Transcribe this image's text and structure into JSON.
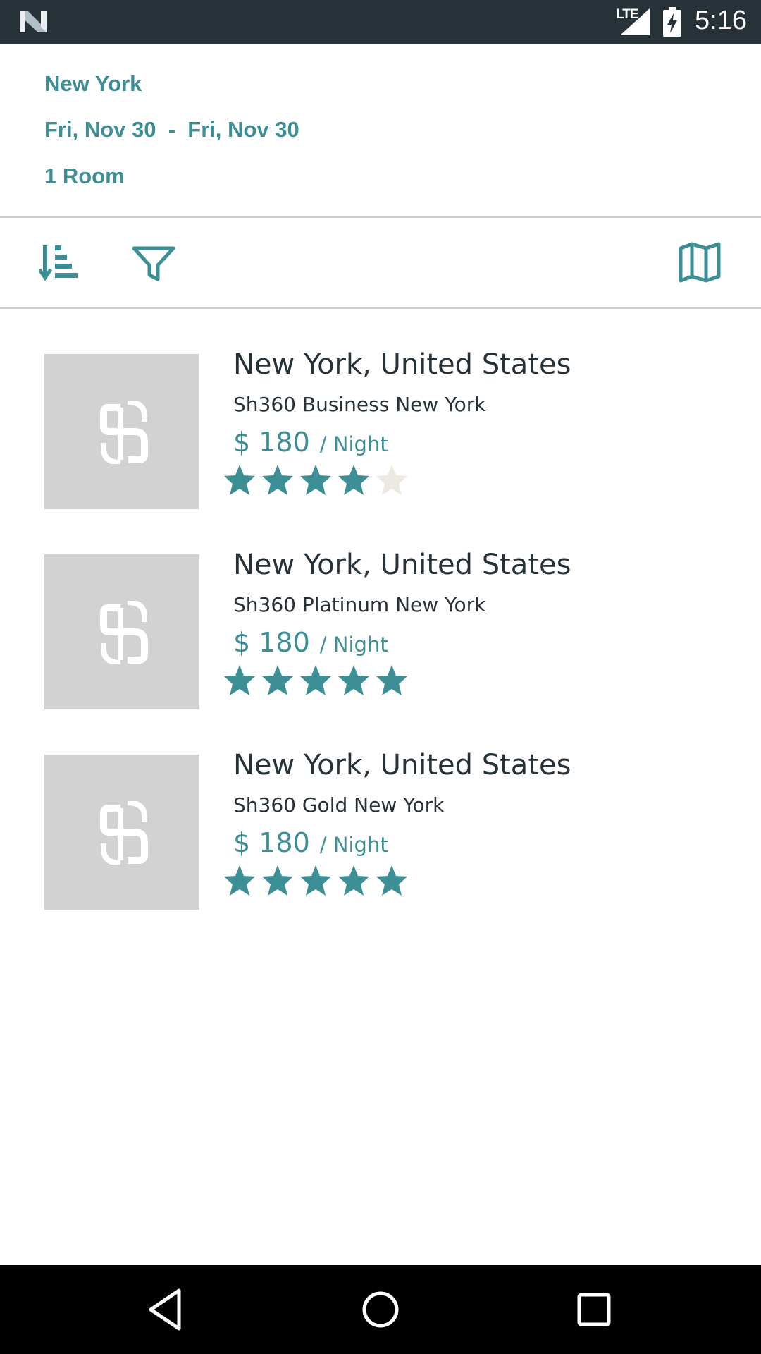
{
  "status_bar": {
    "network": "LTE",
    "time": "5:16",
    "icons": [
      "n-logo-icon",
      "signal-icon",
      "battery-charging-icon"
    ]
  },
  "search": {
    "city": "New York",
    "dates": "Fri, Nov 30  -  Fri, Nov 30",
    "rooms": "1 Room"
  },
  "toolbar": {
    "icons": [
      "sort-icon",
      "filter-icon",
      "map-icon"
    ]
  },
  "colors": {
    "accent": "#3d8f96",
    "text": "#263238",
    "star_empty": "#ece9e1",
    "thumb_bg": "#d2d2d2"
  },
  "hotels": [
    {
      "location": "New York, United States",
      "name": "Sh360 Business New York",
      "price": "$ 180",
      "per": "/  Night",
      "rating": 4,
      "max_rating": 5
    },
    {
      "location": "New York, United States",
      "name": "Sh360 Platinum New York",
      "price": "$ 180",
      "per": "/  Night",
      "rating": 5,
      "max_rating": 5
    },
    {
      "location": "New York, United States",
      "name": "Sh360 Gold New York",
      "price": "$ 180",
      "per": "/  Night",
      "rating": 5,
      "max_rating": 5
    }
  ],
  "nav_bar": {
    "icons": [
      "back-icon",
      "home-icon",
      "recents-icon"
    ]
  }
}
